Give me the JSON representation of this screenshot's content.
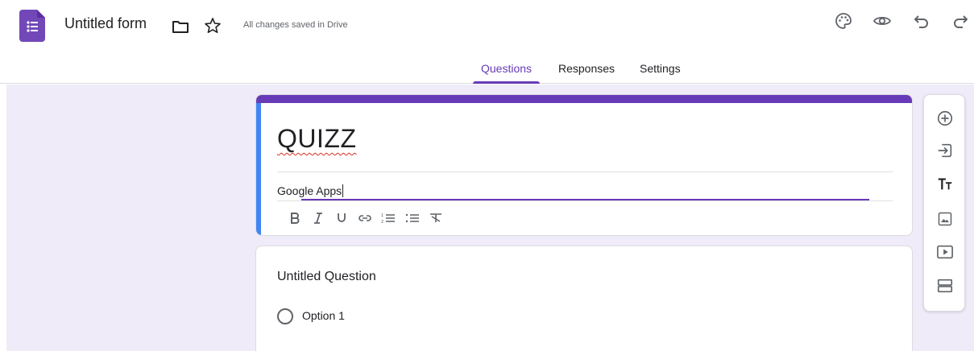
{
  "header": {
    "doc_title": "Untitled form",
    "save_status": "All changes saved in Drive"
  },
  "tabs": [
    {
      "label": "Questions",
      "active": true
    },
    {
      "label": "Responses",
      "active": false
    },
    {
      "label": "Settings",
      "active": false
    }
  ],
  "form": {
    "title": "QUIZZ",
    "description": "Google Apps",
    "format_tools": [
      "bold-icon",
      "italic-icon",
      "underline-icon",
      "link-icon",
      "numbered-list-icon",
      "bulleted-list-icon",
      "clear-formatting-icon"
    ]
  },
  "question": {
    "title": "Untitled Question",
    "options": [
      "Option 1"
    ]
  },
  "side_toolbar": {
    "tools": [
      "add-question-icon",
      "import-questions-icon",
      "add-title-icon",
      "add-image-icon",
      "add-video-icon",
      "add-section-icon"
    ]
  },
  "colors": {
    "accent": "#673ab7",
    "focus_blue": "#4285f4",
    "canvas_bg": "#f0ebf8"
  }
}
